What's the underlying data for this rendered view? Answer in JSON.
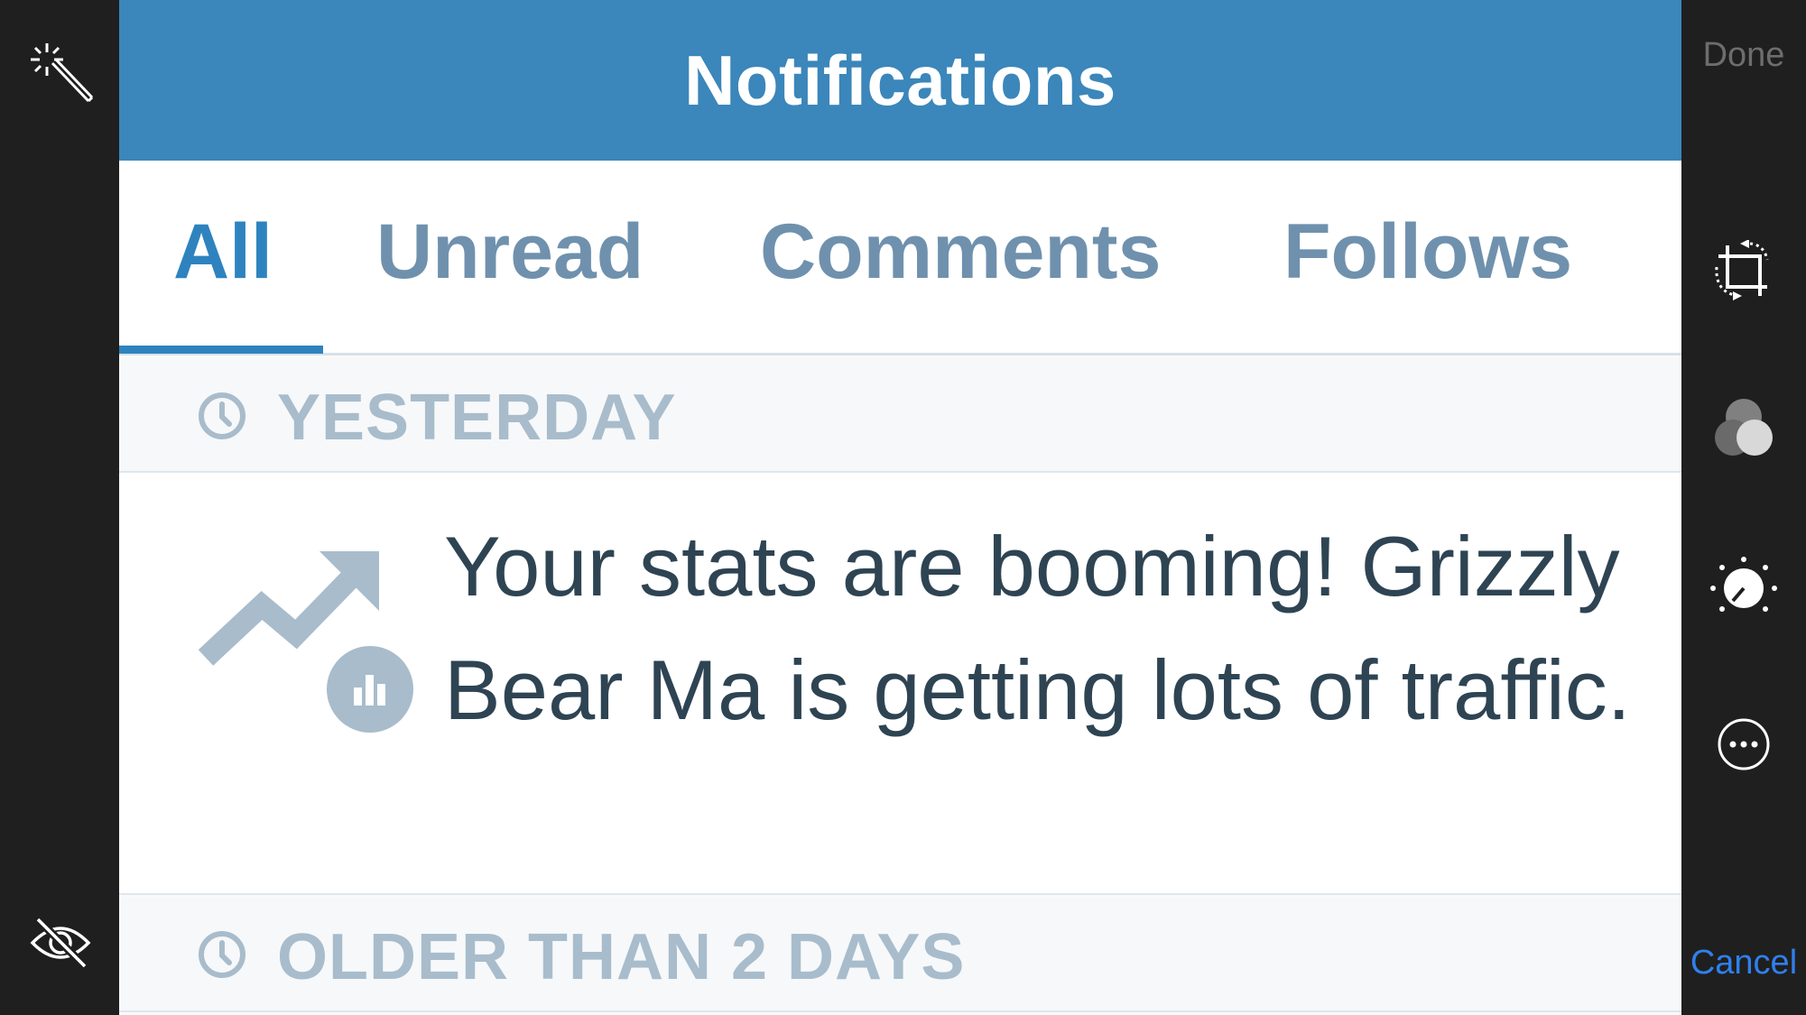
{
  "editor": {
    "done_label": "Done",
    "cancel_label": "Cancel",
    "cancel_color": "#2f80ed",
    "tools": {
      "auto_enhance": "magic-wand-icon",
      "hide": "eye-slash-icon",
      "crop": "crop-rotate-icon",
      "filters": "filters-icon",
      "adjust": "adjust-dial-icon",
      "more": "more-icon"
    }
  },
  "app": {
    "header": {
      "title": "Notifications",
      "background": "#3b86ba"
    },
    "tabs": [
      {
        "label": "All",
        "active": true
      },
      {
        "label": "Unread",
        "active": false
      },
      {
        "label": "Comments",
        "active": false
      },
      {
        "label": "Follows",
        "active": false
      }
    ],
    "sections": [
      {
        "label": "YESTERDAY",
        "icon": "clock-icon",
        "notifications": [
          {
            "icon": "trending-up-icon",
            "badge_icon": "stats-icon",
            "text": "Your stats are booming! Grizzly Bear Ma is getting lots of traffic."
          }
        ]
      },
      {
        "label": "OLDER THAN 2 DAYS",
        "icon": "clock-icon",
        "notifications": []
      }
    ]
  }
}
